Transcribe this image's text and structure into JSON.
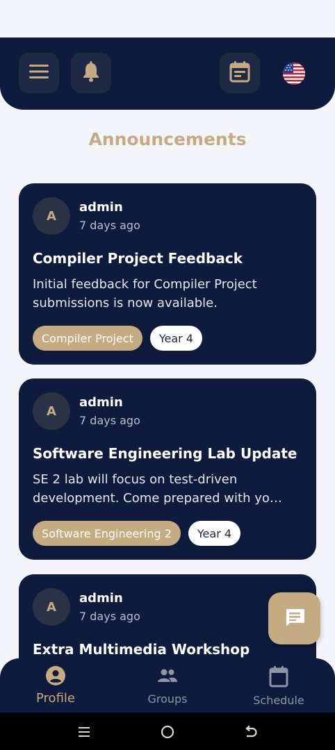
{
  "status_bar": {
    "left_text": "",
    "right_text": ""
  },
  "header": {
    "icons": [
      "menu-icon",
      "bell-icon",
      "calendar-icon",
      "us-flag-icon"
    ],
    "accent_color": "#c4ab82",
    "background_color": "#0f1b3d"
  },
  "page": {
    "title": "Announcements"
  },
  "announcements": [
    {
      "avatar_letter": "A",
      "author": "admin",
      "time": "7 days ago",
      "title": "Compiler Project Feedback",
      "body_line1": "Initial feedback for Compiler Project",
      "body_line2": "submissions is now available.",
      "tag_course": "Compiler Project",
      "tag_year": "Year 4"
    },
    {
      "avatar_letter": "A",
      "author": "admin",
      "time": "7 days ago",
      "title": "Software Engineering Lab Update",
      "body_line1": "SE 2 lab will focus on test-driven",
      "body_line2": "development. Come prepared with yo…",
      "tag_course": "Software Engineering 2",
      "tag_year": "Year 4"
    },
    {
      "avatar_letter": "A",
      "author": "admin",
      "time": "7 days ago",
      "title": "Extra Multimedia Workshop"
    }
  ],
  "fab": {
    "icon": "chat-icon"
  },
  "bottom_nav": {
    "items": [
      {
        "label": "Profile",
        "icon": "profile-icon",
        "active": true
      },
      {
        "label": "Groups",
        "icon": "groups-icon",
        "active": false
      },
      {
        "label": "Schedule",
        "icon": "schedule-icon",
        "active": false
      }
    ]
  },
  "system_nav": {
    "icons": [
      "recents-icon",
      "home-icon",
      "back-icon"
    ]
  }
}
